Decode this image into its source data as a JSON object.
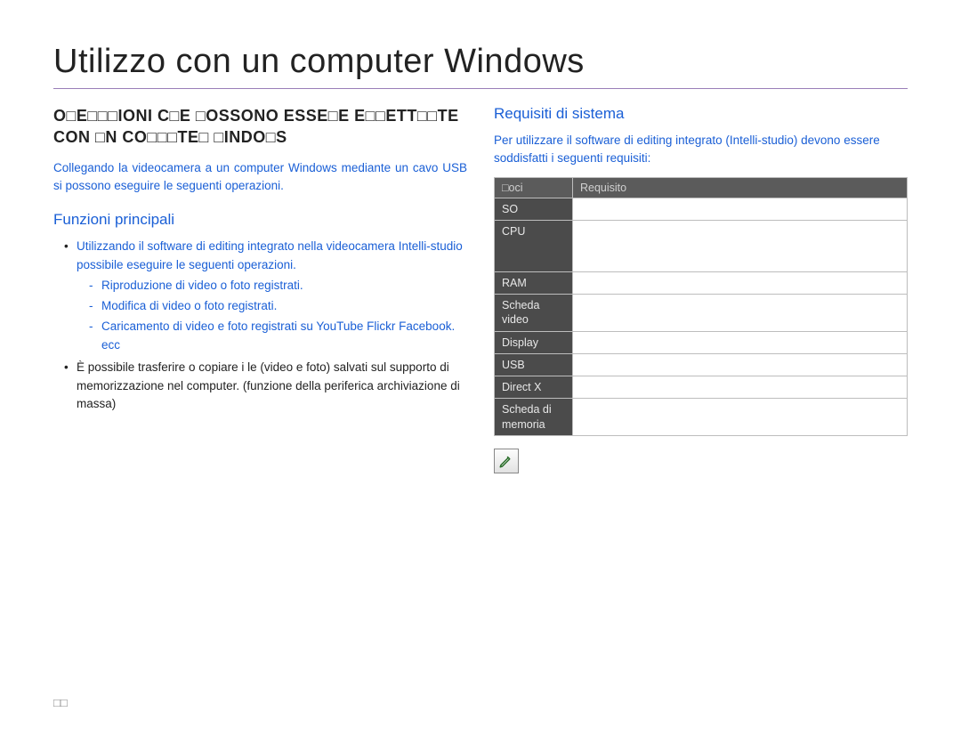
{
  "title": "Utilizzo con un computer Windows",
  "left": {
    "heading": "O□E□□□IONI C□E □OSSONO ESSE□E E□□ETT□□TE CON □N CO□□□TE□ □INDO□S",
    "intro": "Collegando la videocamera a un computer Windows mediante un cavo USB si possono eseguire le seguenti operazioni.",
    "sub_heading": "Funzioni principali",
    "b1_lead": "Utilizzando il software di editing integrato nella videocamera Intelli-studio    possibile eseguire le seguenti operazioni.",
    "b1_s1": "Riproduzione di video o foto registrati.",
    "b1_s2": "Modifica di video o foto registrati.",
    "b1_s3": "Caricamento di video e foto registrati su YouTube  Flickr  Facebook. ecc",
    "b2": "È possibile trasferire o copiare i  le (video e foto) salvati sul supporto di memorizzazione nel computer. (funzione della periferica archiviazione di massa)"
  },
  "right": {
    "sub_heading": "Requisiti di sistema",
    "intro": "Per utilizzare il software di editing integrato (Intelli-studio)  devono essere soddisfatti i seguenti requisiti:",
    "table": {
      "h1": "□oci",
      "h2": "Requisito",
      "rows": [
        "SO",
        "CPU",
        "RAM",
        "Scheda video",
        "Display",
        "USB",
        "Direct X",
        "Scheda di memoria"
      ]
    }
  },
  "page_number": "□□"
}
